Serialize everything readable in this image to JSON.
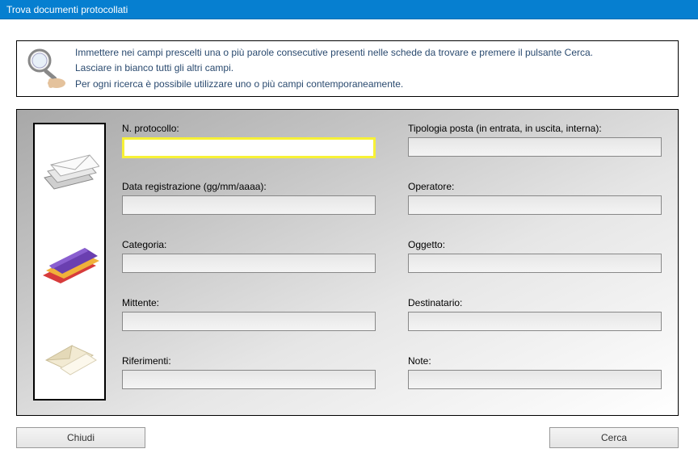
{
  "window": {
    "title": "Trova documenti protocollati"
  },
  "instructions": {
    "line1": "Immettere nei campi prescelti una o più parole consecutive presenti nelle schede da trovare e premere il pulsante Cerca.",
    "line2": "Lasciare in bianco tutti gli altri campi.",
    "line3": "Per ogni ricerca è possibile utilizzare uno o più campi contemporaneamente."
  },
  "fields": {
    "protocollo": {
      "label": "N. protocollo:",
      "value": ""
    },
    "tipologia": {
      "label": "Tipologia posta (in entrata, in uscita, interna):",
      "value": ""
    },
    "data": {
      "label": "Data registrazione (gg/mm/aaaa):",
      "value": ""
    },
    "operatore": {
      "label": "Operatore:",
      "value": ""
    },
    "categoria": {
      "label": "Categoria:",
      "value": ""
    },
    "oggetto": {
      "label": "Oggetto:",
      "value": ""
    },
    "mittente": {
      "label": "Mittente:",
      "value": ""
    },
    "destinatario": {
      "label": "Destinatario:",
      "value": ""
    },
    "riferimenti": {
      "label": "Riferimenti:",
      "value": ""
    },
    "note": {
      "label": "Note:",
      "value": ""
    }
  },
  "buttons": {
    "close": "Chiudi",
    "search": "Cerca"
  },
  "icons": {
    "magnifier": "magnifier-icon",
    "envelopes": "envelopes-icon",
    "folders": "folders-icon",
    "paper": "paper-icon"
  }
}
